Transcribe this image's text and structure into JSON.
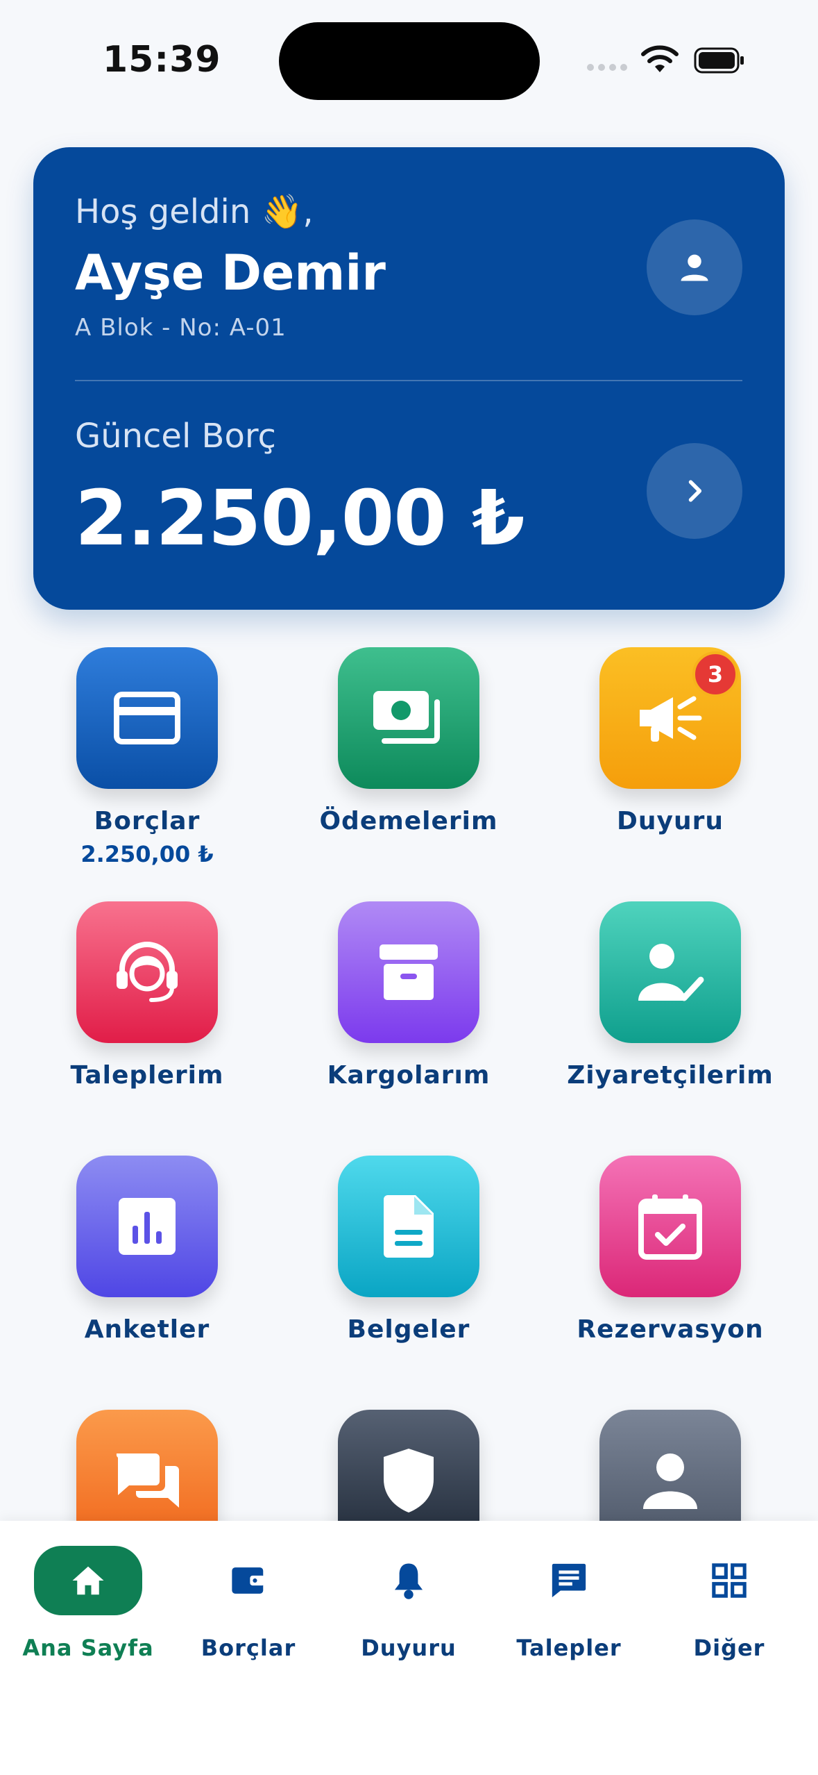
{
  "status_bar": {
    "time": "15:39"
  },
  "hero": {
    "greeting": "Hoş geldin 👋,",
    "user_name": "Ayşe Demir",
    "unit_info": "A Blok - No: A-01",
    "debt_label": "Güncel Borç",
    "debt_amount": "2.250,00 ₺"
  },
  "tiles": [
    {
      "label": "Borçlar",
      "sub": "2.250,00 ₺",
      "icon": "credit-card-icon"
    },
    {
      "label": "Ödemelerim",
      "icon": "money-icon"
    },
    {
      "label": "Duyuru",
      "badge": "3",
      "icon": "megaphone-icon"
    },
    {
      "label": "Taleplerim",
      "icon": "headset-icon"
    },
    {
      "label": "Kargolarım",
      "icon": "archive-box-icon"
    },
    {
      "label": "Ziyaretçilerim",
      "icon": "person-check-icon"
    },
    {
      "label": "Anketler",
      "icon": "poll-chart-icon"
    },
    {
      "label": "Belgeler",
      "icon": "document-icon"
    },
    {
      "label": "Rezervasyon",
      "icon": "calendar-check-icon"
    },
    {
      "label": "",
      "icon": "chat-bubbles-icon"
    },
    {
      "label": "",
      "icon": "shield-icon"
    },
    {
      "label": "",
      "icon": "person-icon"
    }
  ],
  "bottom_nav": [
    {
      "label": "Ana Sayfa",
      "icon": "home-icon",
      "active": true
    },
    {
      "label": "Borçlar",
      "icon": "wallet-icon"
    },
    {
      "label": "Duyuru",
      "icon": "bell-icon"
    },
    {
      "label": "Talepler",
      "icon": "message-icon"
    },
    {
      "label": "Diğer",
      "icon": "grid-icon"
    }
  ],
  "colors": {
    "primary": "#05499b",
    "active_nav": "#0f7f54",
    "badge": "#e53935"
  }
}
